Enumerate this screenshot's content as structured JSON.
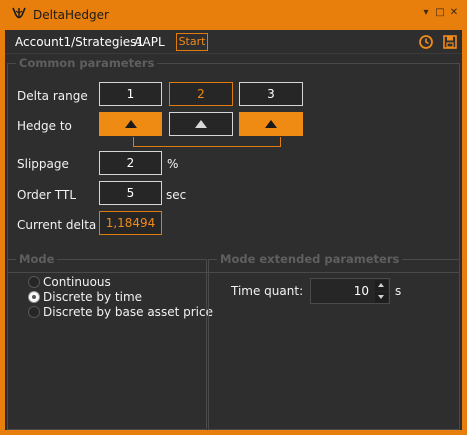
{
  "window": {
    "title": "DeltaHedger",
    "controls": [
      "minimize-arrow",
      "maximize",
      "close"
    ]
  },
  "header": {
    "strategy": "Account1/Strategies1",
    "symbol": "AAPL",
    "start_label": "Start",
    "icons": [
      "clock-icon",
      "save-icon"
    ]
  },
  "common": {
    "title": "Common parameters",
    "delta_range": {
      "label": "Delta range",
      "values": [
        "1",
        "2",
        "3"
      ]
    },
    "hedge_to": {
      "label": "Hedge to"
    },
    "slippage": {
      "label": "Slippage",
      "value": "2",
      "unit": "%"
    },
    "order_ttl": {
      "label": "Order TTL",
      "value": "5",
      "unit": "sec"
    },
    "current_delta": {
      "label": "Current delta",
      "value": "1,18494"
    }
  },
  "mode": {
    "title": "Mode",
    "options": [
      "Continuous",
      "Discrete by time",
      "Discrete by base asset price"
    ],
    "selected": "Discrete by time"
  },
  "extended": {
    "title": "Mode extended parameters",
    "time_quant": {
      "label": "Time quant:",
      "value": "10",
      "unit": "s"
    }
  },
  "colors": {
    "accent": "#ef8a12",
    "panel": "#2e2e2e",
    "text": "#f2f2f2",
    "muted": "#5f5f5f"
  }
}
